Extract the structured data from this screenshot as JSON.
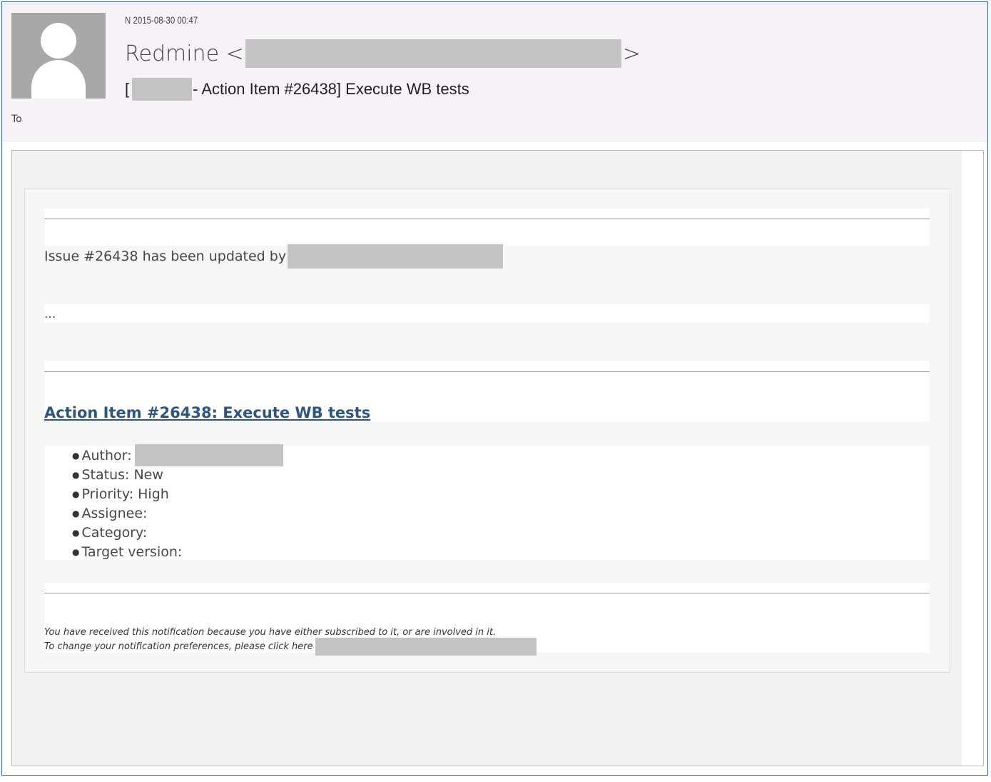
{
  "header": {
    "date_line": "N 2015-08-30 00:47",
    "sender_name": "Redmine <",
    "sender_close": ">",
    "subject_open": "[",
    "subject_rest": "- Action Item #26438] Execute WB tests",
    "to_label": "To"
  },
  "body": {
    "issue_updated_text": "Issue #26438 has been updated by",
    "ellipsis": "...",
    "issue_link": "Action Item #26438: Execute WB tests",
    "attributes": [
      {
        "label": "Author:",
        "value": ""
      },
      {
        "label": "Status:",
        "value": "New"
      },
      {
        "label": "Priority:",
        "value": "High"
      },
      {
        "label": "Assignee:",
        "value": ""
      },
      {
        "label": "Category:",
        "value": ""
      },
      {
        "label": "Target version:",
        "value": ""
      }
    ],
    "bullet": "●",
    "footer_line1": "You have received this notification because you have either subscribed to it, or are involved in it.",
    "footer_line2": "To change your notification preferences, please click here"
  }
}
